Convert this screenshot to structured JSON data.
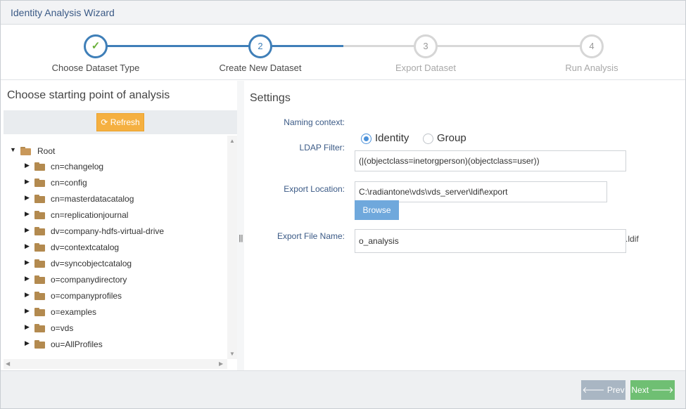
{
  "window": {
    "title": "Identity Analysis Wizard"
  },
  "steps": [
    {
      "number": "",
      "icon": "check-icon",
      "glyph": "✓",
      "label": "Choose Dataset Type",
      "state": "done"
    },
    {
      "number": "2",
      "label": "Create New Dataset",
      "state": "active"
    },
    {
      "number": "3",
      "label": "Export Dataset",
      "state": "todo"
    },
    {
      "number": "4",
      "label": "Run Analysis",
      "state": "todo"
    }
  ],
  "left_panel": {
    "heading": "Choose starting point of analysis",
    "refresh_label": "Refresh",
    "refresh_icon": "refresh-icon",
    "tree": {
      "root": "Root",
      "children": [
        "cn=changelog",
        "cn=config",
        "cn=masterdatacatalog",
        "cn=replicationjournal",
        "dv=company-hdfs-virtual-drive",
        "dv=contextcatalog",
        "dv=syncobjectcatalog",
        "o=companydirectory",
        "o=companyprofiles",
        "o=examples",
        "o=vds",
        "ou=AllProfiles"
      ]
    }
  },
  "settings": {
    "heading": "Settings",
    "naming_context_label": "Naming context:",
    "radio_identity": "Identity",
    "radio_group": "Group",
    "selected_radio": "Identity",
    "ldap_filter_label": "LDAP Filter:",
    "ldap_filter_value": "(|(objectclass=inetorgperson)(objectclass=user))",
    "export_location_label": "Export Location:",
    "export_location_value": "C:\\radiantone\\vds\\vds_server\\ldif\\export",
    "browse_label": "Browse",
    "export_file_label": "Export File Name:",
    "export_file_value": "o_analysis",
    "export_file_suffix": ".ldif"
  },
  "footer": {
    "prev_label": "Prev",
    "next_label": "Next"
  },
  "colors": {
    "accent": "#3f7fb8",
    "refresh": "#f5b041",
    "next": "#6fbf73",
    "prev": "#a9b6c3",
    "folder": "#b38a4f"
  }
}
